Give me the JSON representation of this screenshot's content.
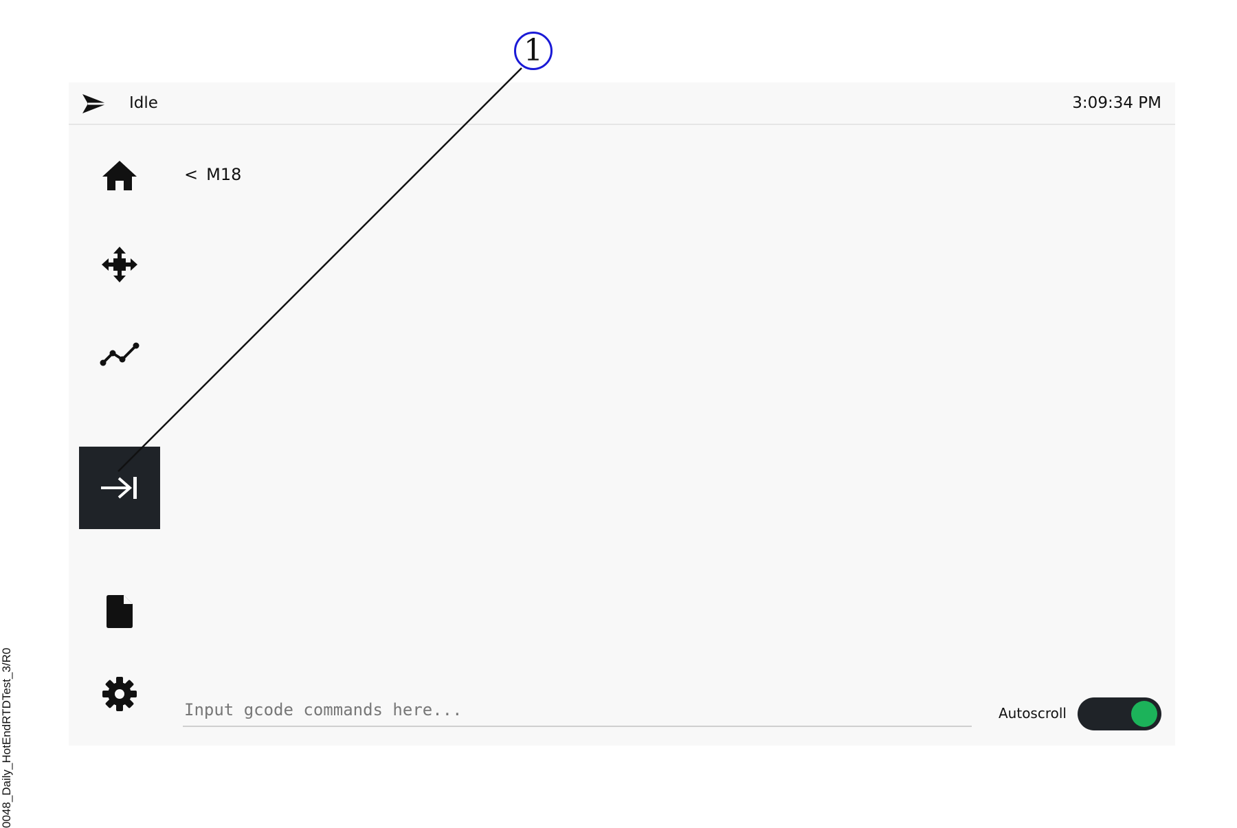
{
  "document_id": "0048_Daily_HotEndRTDTest_3/R0",
  "callout": {
    "number": "1"
  },
  "topbar": {
    "logo_icon": "send-arrow-logo-icon",
    "status": "Idle",
    "clock": "3:09:34 PM"
  },
  "sidebar": {
    "items": [
      {
        "id": "home",
        "icon": "home-icon",
        "active": false
      },
      {
        "id": "move",
        "icon": "move-arrows-icon",
        "active": false
      },
      {
        "id": "graph",
        "icon": "line-graph-icon",
        "active": false
      },
      {
        "id": "console",
        "icon": "arrow-to-bar-icon",
        "active": true
      },
      {
        "id": "files",
        "icon": "file-icon",
        "active": false
      },
      {
        "id": "settings",
        "icon": "gear-icon",
        "active": false
      }
    ]
  },
  "console": {
    "back_chevron": "<",
    "last_command": "M18",
    "input_value": "",
    "input_placeholder": "Input gcode commands here...",
    "autoscroll_label": "Autoscroll",
    "autoscroll_on": true
  },
  "colors": {
    "background": "#f8f8f8",
    "active_nav": "#1f2328",
    "toggle_knob": "#1cb35a",
    "callout_circle": "#1a1ad6"
  }
}
